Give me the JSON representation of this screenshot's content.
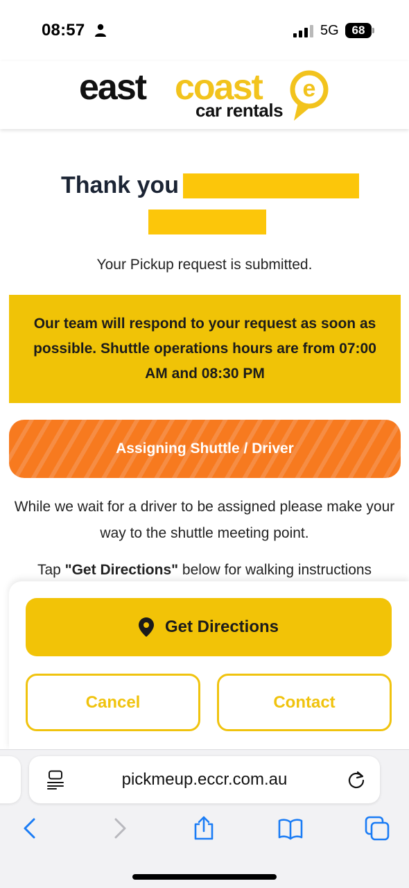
{
  "status_bar": {
    "time": "08:57",
    "network": "5G",
    "battery": "68"
  },
  "header": {
    "logo_east": "east",
    "logo_coast": "coast",
    "logo_sub": "car rentals",
    "logo_mark": "e"
  },
  "main": {
    "thank_you": "Thank you",
    "submitted": "Your Pickup request is submitted.",
    "notice": "Our team will respond to your request as soon as possible. Shuttle operations hours are from 07:00 AM and 08:30 PM",
    "status_pill": "Assigning Shuttle / Driver",
    "wait_text": "While we wait for a driver to be assigned please make your way to the shuttle meeting point.",
    "tap_prefix": "Tap ",
    "tap_bold": "\"Get Directions\"",
    "tap_suffix": " below for walking instructions"
  },
  "actions": {
    "get_directions": "Get Directions",
    "cancel": "Cancel",
    "contact": "Contact"
  },
  "browser": {
    "url": "pickmeup.eccr.com.au"
  },
  "icons": {
    "person": "person-icon",
    "signal": "signal-icon",
    "pin": "location-pin-icon",
    "reader": "reader-mode-icon",
    "reload": "reload-icon",
    "back": "back-icon",
    "forward": "forward-icon",
    "share": "share-icon",
    "bookmarks": "bookmarks-icon",
    "tabs": "tabs-icon"
  },
  "colors": {
    "brand_yellow": "#f2c307",
    "redaction": "#fcc60a",
    "status_orange": "#f77a1f",
    "ios_blue": "#1a7cf5"
  }
}
